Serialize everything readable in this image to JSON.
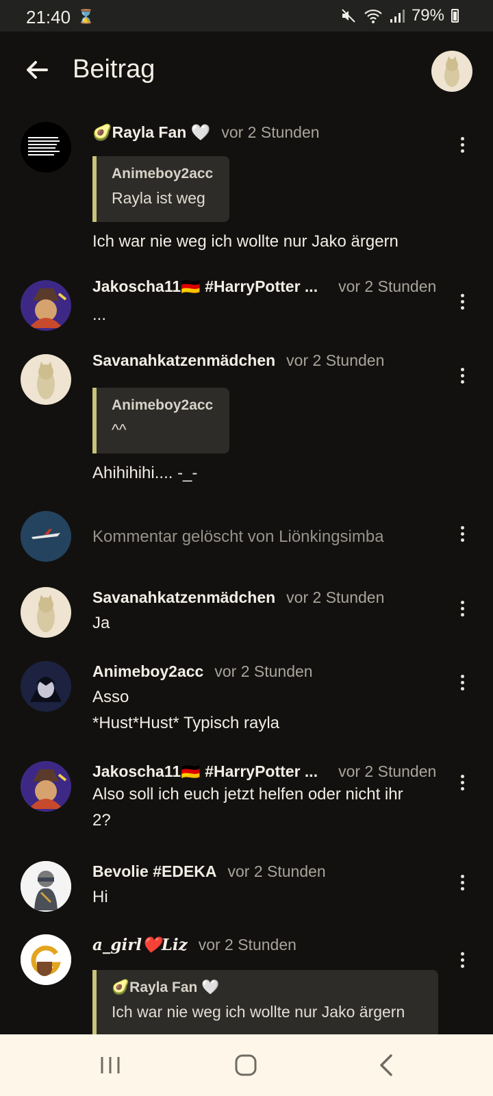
{
  "status": {
    "time": "21:40",
    "battery": "79%"
  },
  "header": {
    "title": "Beitrag"
  },
  "comments": [
    {
      "author": "🥑Rayla Fan 🤍",
      "time": "vor 2 Stunden",
      "quote_author": "Animeboy2acc",
      "quote_text": "Rayla ist weg",
      "text": "Ich war nie weg ich wollte nur Jako ärgern"
    },
    {
      "author": "Jakoscha11🇩🇪 #HarryPotter ...",
      "time": "vor 2 Stunden",
      "text": "..."
    },
    {
      "author": "Savanahkatzenmädchen",
      "time": "vor 2 Stunden",
      "quote_author": "Animeboy2acc",
      "quote_text": "^^",
      "text": "Ahihihihi.... -_-"
    },
    {
      "deleted_text": "Kommentar gelöscht von Liönkingsimba"
    },
    {
      "author": "Savanahkatzenmädchen",
      "time": "vor 2 Stunden",
      "text": "Ja"
    },
    {
      "author": "Animeboy2acc",
      "time": "vor 2 Stunden",
      "text": "Asso\n*Hust*Hust* Typisch rayla"
    },
    {
      "author": "Jakoscha11🇩🇪 #HarryPotter ...",
      "time": "vor 2 Stunden",
      "text": "Also soll ich euch jetzt helfen oder nicht ihr\n2?"
    },
    {
      "author": "Bevolie #EDEKA",
      "time": "vor 2 Stunden",
      "text": "Hi"
    },
    {
      "author": "a_girl❤️Liz",
      "time": "vor 2 Stunden",
      "quote_author": "🥑Rayla Fan 🤍",
      "quote_text": "Ich war nie weg ich wollte nur Jako ärgern"
    }
  ],
  "colors": {
    "background": "#12110f",
    "quote_bar": "#c9c37a",
    "navbar": "#fdf6e9"
  },
  "icons": {
    "back": "arrow-left-icon",
    "more": "more-vert-icon",
    "recents": "recents-icon",
    "home": "home-icon",
    "nav_back": "chevron-left-icon"
  }
}
